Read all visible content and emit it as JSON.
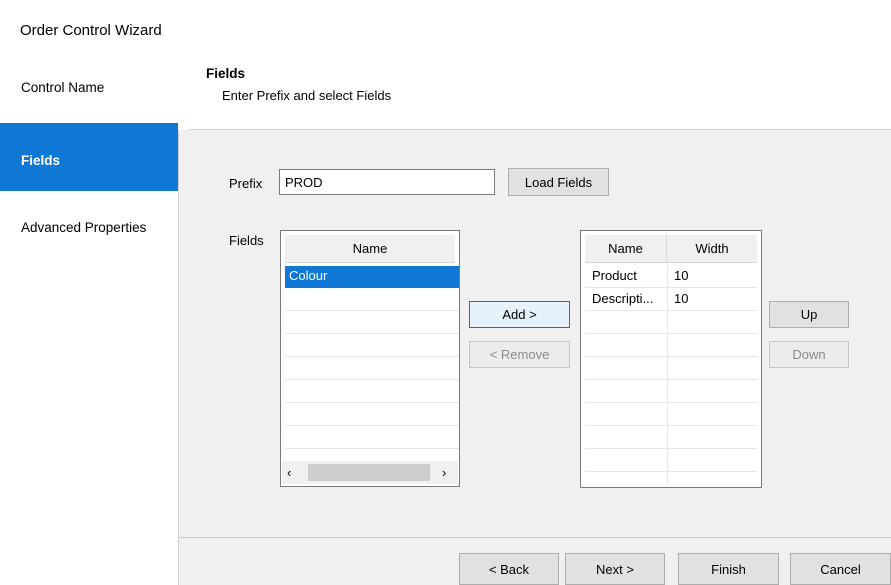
{
  "window": {
    "title": "Order Control Wizard"
  },
  "sidebar": {
    "items": [
      {
        "label": "Control Name",
        "active": false
      },
      {
        "label": "Fields",
        "active": true
      },
      {
        "label": "Advanced Properties",
        "active": false
      }
    ]
  },
  "header": {
    "title": "Fields",
    "subtitle": "Enter Prefix and select Fields"
  },
  "form": {
    "prefix_label": "Prefix",
    "prefix_value": "PROD",
    "load_fields_label": "Load Fields",
    "fields_label": "Fields"
  },
  "available_list": {
    "header": "Name",
    "items": [
      "Colour"
    ],
    "selected": "Colour"
  },
  "selected_list": {
    "columns": [
      "Name",
      "Width"
    ],
    "rows": [
      {
        "name": "Product",
        "width": "10"
      },
      {
        "name": "Descripti...",
        "width": "10"
      }
    ]
  },
  "buttons": {
    "add": "Add >",
    "remove": "< Remove",
    "up": "Up",
    "down": "Down",
    "back": "< Back",
    "next": "Next >",
    "finish": "Finish",
    "cancel": "Cancel"
  },
  "scrollbar": {
    "left_glyph": "‹",
    "right_glyph": "›"
  },
  "colors": {
    "accent": "#0f78d4",
    "panel_bg": "#f0f0f0",
    "button_bg": "#e1e1e1",
    "disabled_text": "#8b8b8b"
  }
}
